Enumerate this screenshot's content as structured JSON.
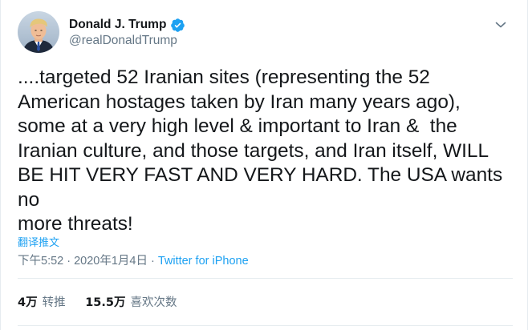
{
  "user": {
    "display_name": "Donald J. Trump",
    "handle": "@realDonaldTrump",
    "verified": true,
    "avatar_icon": "profile-photo",
    "verified_icon": "verified-badge-icon",
    "verified_color": "#1da1f2"
  },
  "tweet": {
    "text": "....targeted 52 Iranian sites (representing the 52\nAmerican hostages taken by Iran many years ago),\nsome at a very high level & important to Iran &  the\nIranian culture, and those targets, and Iran itself, WILL\nBE HIT VERY FAST AND VERY HARD. The USA wants no\nmore threats!",
    "translate_label": "翻译推文"
  },
  "meta": {
    "time": "下午5:52",
    "separator": "·",
    "date": "2020年1月4日",
    "source": "Twitter for iPhone"
  },
  "stats": {
    "retweets_count": "4万",
    "retweets_label": "转推",
    "likes_count": "15.5万",
    "likes_label": "喜欢次数"
  },
  "colors": {
    "link": "#1da1f2",
    "secondary_text": "#657786",
    "primary_text": "#14171a",
    "divider": "#e6ecf0"
  }
}
